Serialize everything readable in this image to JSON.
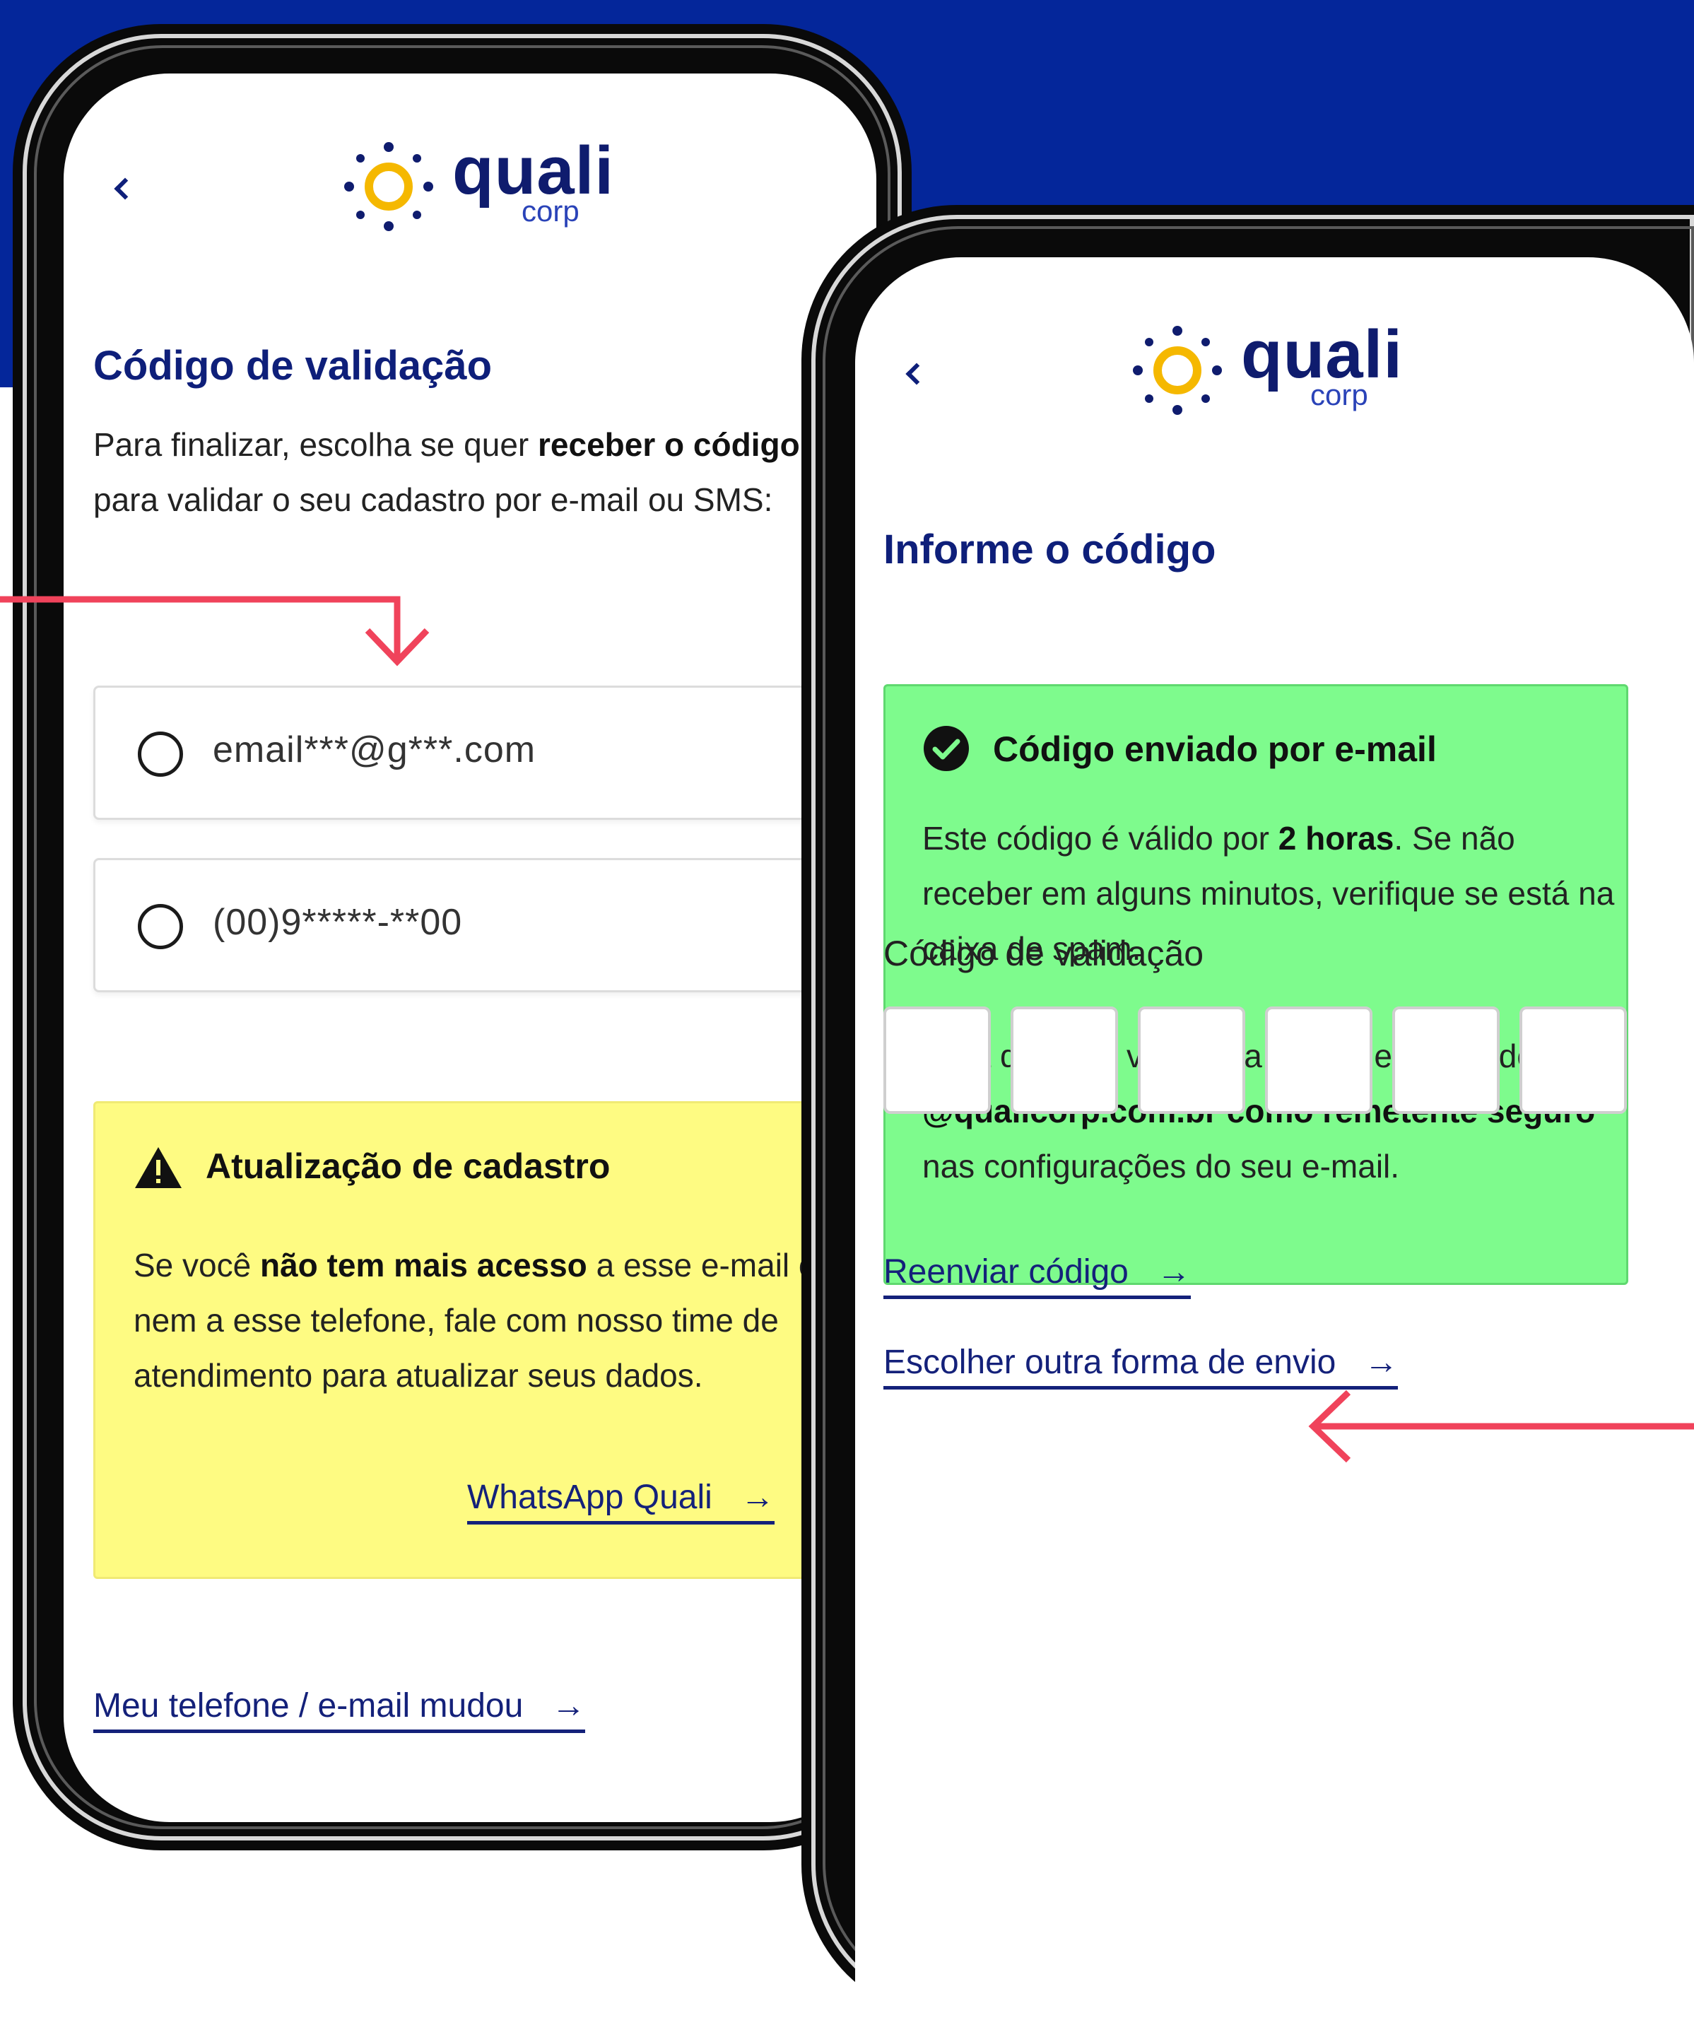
{
  "colors": {
    "background_blue": "#04269a",
    "brand_navy": "#0e1f7a",
    "warning_yellow": "#fefb82",
    "success_green": "#7efb8d",
    "callout_red": "#f0435b"
  },
  "logo": {
    "word": "quali",
    "sub": "corp"
  },
  "screen_left": {
    "back_icon": "chevron-left-icon",
    "title": "Código de validação",
    "intro_1": "Para finalizar, escolha se quer ",
    "intro_bold_1": "receber o código",
    "intro_2": " para validar o seu cadastro por e-mail ou SMS:",
    "options": [
      {
        "label": "email***@g***.com"
      },
      {
        "label": "(00)9*****-**00"
      }
    ],
    "alert": {
      "icon": "warning-triangle-icon",
      "title": "Atualização de cadastro",
      "text_1": "Se você ",
      "text_bold": "não tem mais acesso",
      "text_2": " a esse e-mail e nem a esse telefone, fale com nosso time de atendimento para atualizar seus dados.",
      "link": "WhatsApp Quali"
    },
    "footer_link": "Meu telefone / e-mail mudou"
  },
  "screen_right": {
    "back_icon": "chevron-left-icon",
    "title": "Informe o código",
    "alert": {
      "icon": "check-circle-icon",
      "title": "Código enviado por e-mail",
      "p1_1": "Este código é válido por ",
      "p1_bold": "2 horas",
      "p1_2": ". Se não receber em alguns minutos, verifique se está na caixa de spam.",
      "p2_1": "Para que não vá para a caixa de spam, defina ",
      "p2_bold": "@qualicorp.com.br como remetente seguro",
      "p2_2": " nas configurações do seu e-mail."
    },
    "code_label": "Código de validação",
    "code_digits": [
      "",
      "",
      "",
      "",
      "",
      ""
    ],
    "resend_link": "Reenviar código",
    "other_method_link": "Escolher outra forma de envio"
  }
}
